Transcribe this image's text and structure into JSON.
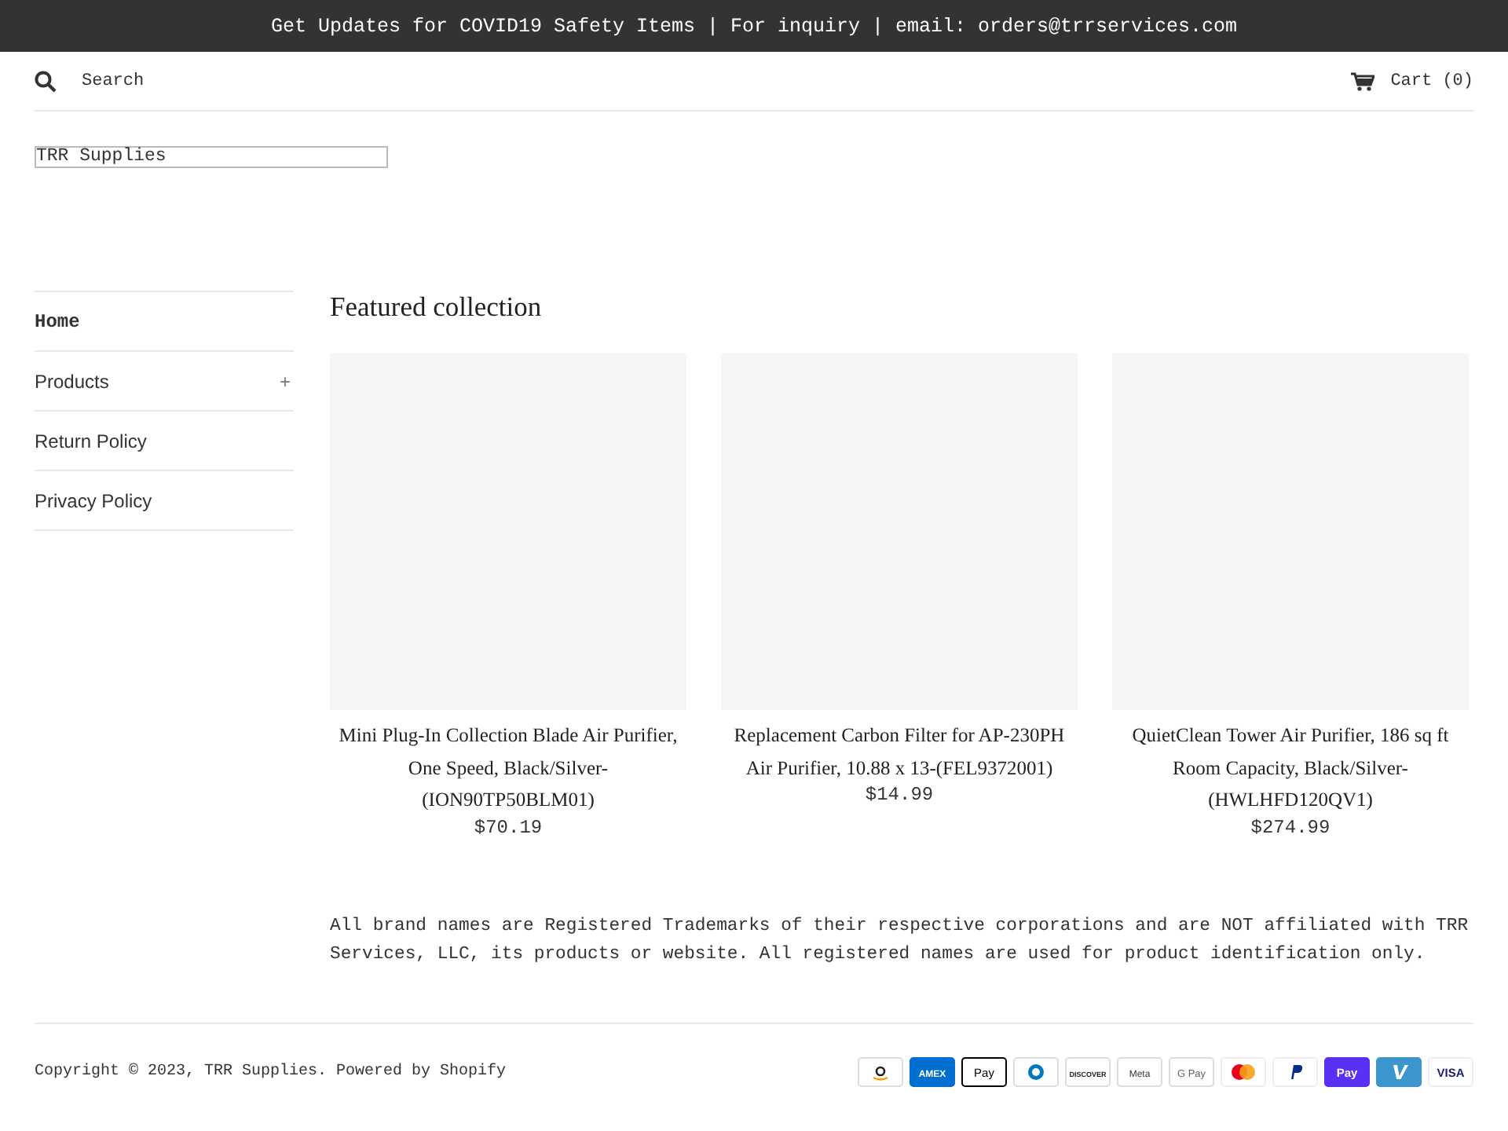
{
  "announcement": "Get Updates for COVID19 Safety Items | For inquiry | email: orders@trrservices.com",
  "header": {
    "search": {
      "placeholder": "Search"
    },
    "cart": "Cart (0)"
  },
  "logo": "TRR Supplies",
  "sidebar": {
    "items": [
      {
        "label": "Home",
        "selected": true
      },
      {
        "label": "Products",
        "selected": false,
        "expander": "+"
      },
      {
        "label": "Return Policy",
        "selected": false
      },
      {
        "label": "Privacy Policy",
        "selected": false
      }
    ]
  },
  "featured": {
    "title": "Featured collection",
    "products": [
      {
        "title": "Mini Plug-In Collection Blade Air Purifier, One Speed, Black/Silver-(ION90TP50BLM01)",
        "price": "$70.19"
      },
      {
        "title": "Replacement Carbon Filter for AP-230PH Air Purifier, 10.88 x 13-(FEL9372001)",
        "price": "$14.99"
      },
      {
        "title": "QuietClean Tower Air Purifier, 186 sq ft Room Capacity, Black/Silver-(HWLHFD120QV1)",
        "price": "$274.99"
      }
    ]
  },
  "disclaimer": "All brand names are Registered Trademarks of their respective corporations and are NOT affiliated with TRR Services, LLC, its products or website. All registered names are used for product identification only.",
  "footer": {
    "copyright": "Copyright © 2023, TRR Supplies. Powered by Shopify",
    "payments": [
      {
        "kind": "amazon"
      },
      {
        "kind": "amex",
        "label": "AMEX"
      },
      {
        "kind": "applepay",
        "label": "Pay"
      },
      {
        "kind": "diners"
      },
      {
        "kind": "discover",
        "label": "DISCOVER"
      },
      {
        "kind": "meta",
        "label": "Meta"
      },
      {
        "kind": "googlepay",
        "label": "G Pay"
      },
      {
        "kind": "mastercard"
      },
      {
        "kind": "paypal"
      },
      {
        "kind": "shoppay",
        "label": "Pay"
      },
      {
        "kind": "venmo"
      },
      {
        "kind": "visa",
        "label": "VISA"
      }
    ]
  }
}
